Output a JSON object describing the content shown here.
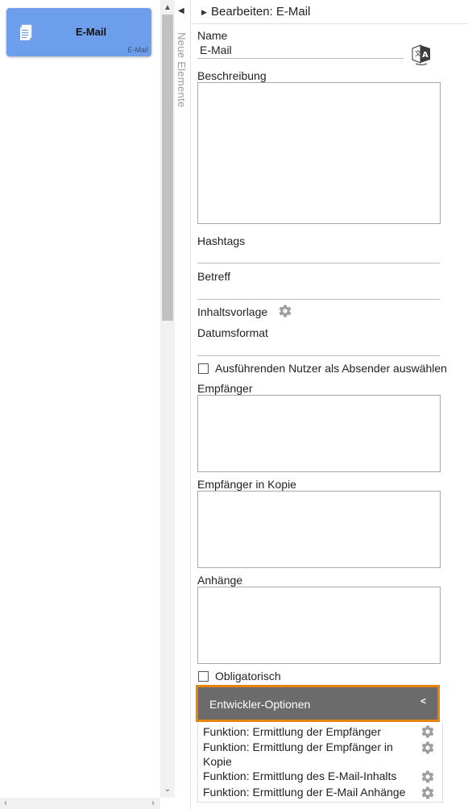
{
  "canvas": {
    "node": {
      "title": "E-Mail",
      "type": "E-Mail",
      "icon": "document-icon"
    }
  },
  "side_panel": {
    "label": "Neue Elemente"
  },
  "props": {
    "header_title": "Bearbeiten: E-Mail",
    "name_label": "Name",
    "name_value": "E-Mail",
    "description_label": "Beschreibung",
    "hashtags_label": "Hashtags",
    "subject_label": "Betreff",
    "template_label": "Inhaltsvorlage",
    "date_format_label": "Datumsformat",
    "sender_checkbox_label": "Ausführenden Nutzer als Absender auswählen",
    "recipients_label": "Empfänger",
    "cc_label": "Empfänger in Kopie",
    "attachments_label": "Anhänge",
    "mandatory_label": "Obligatorisch",
    "dev_options_label": "Entwickler-Optionen",
    "functions": [
      {
        "label": "Funktion: Ermittlung der Empfänger"
      },
      {
        "label": "Funktion: Ermittlung der Empfänger in Kopie"
      },
      {
        "label": "Funktion: Ermittlung des E-Mail-Inhalts"
      },
      {
        "label": "Funktion: Ermittlung der E-Mail Anhänge"
      }
    ]
  },
  "colors": {
    "node_fill": "#6d9eeb",
    "dev_header": "#6b6b6b",
    "dev_border": "#e8830c"
  }
}
